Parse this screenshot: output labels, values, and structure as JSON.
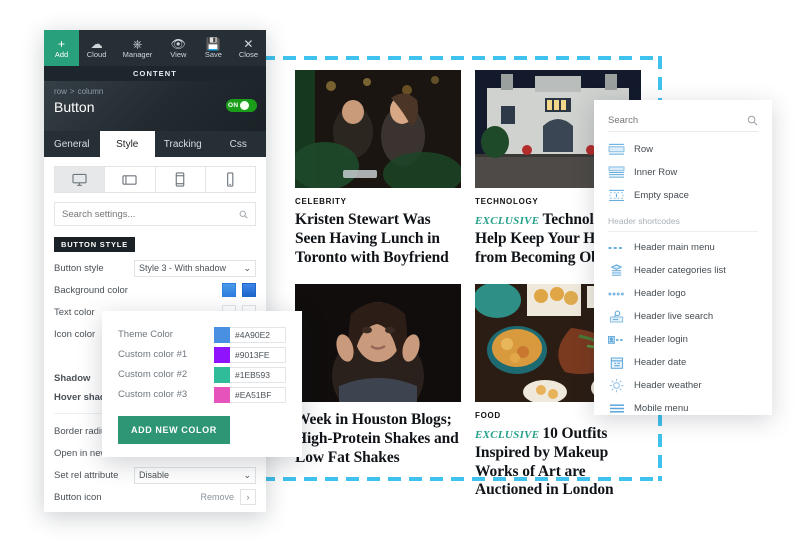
{
  "builder": {
    "toolbar": [
      {
        "label": "Add",
        "icon": "plus-icon"
      },
      {
        "label": "Cloud",
        "icon": "cloud-icon"
      },
      {
        "label": "Manager",
        "icon": "manager-icon"
      },
      {
        "label": "View",
        "icon": "eye-icon"
      },
      {
        "label": "Save",
        "icon": "save-disk-icon"
      },
      {
        "label": "Close",
        "icon": "close-x-icon"
      }
    ],
    "content_bar": "CONTENT",
    "breadcrumb": {
      "parent": "row",
      "separator": ">",
      "child": "column"
    },
    "object_name": "Button",
    "toggle": {
      "label": "ON",
      "state": "on"
    },
    "tabs": [
      {
        "label": "General",
        "active": false
      },
      {
        "label": "Style",
        "active": true
      },
      {
        "label": "Tracking",
        "active": false
      },
      {
        "label": "Css",
        "active": false
      }
    ],
    "devices": [
      {
        "name": "desktop",
        "active": true
      },
      {
        "name": "tablet-landscape",
        "active": false
      },
      {
        "name": "tablet-portrait",
        "active": false
      },
      {
        "name": "mobile",
        "active": false
      }
    ],
    "search": {
      "placeholder": "Search settings...",
      "value": ""
    },
    "section_label": "BUTTON STYLE",
    "fields": {
      "button_style": {
        "label": "Button style",
        "value": "Style 3 - With shadow"
      },
      "background_color": {
        "label": "Background color"
      },
      "text_color": {
        "label": "Text color"
      },
      "icon_color": {
        "label": "Icon color"
      },
      "shadow": {
        "label": "Shadow"
      },
      "hover_shadow": {
        "label": "Hover shadow"
      },
      "border_radius": {
        "label": "Border radius"
      },
      "open_in_new": {
        "label": "Open in new tab"
      },
      "set_rel": {
        "label": "Set rel attribute",
        "value": "Disable"
      },
      "button_icon": {
        "label": "Button icon",
        "action": "Remove"
      }
    }
  },
  "picker": {
    "rows": [
      {
        "name": "Theme Color",
        "hex": "#4A90E2",
        "swatch": "#4a90e2"
      },
      {
        "name": "Custom color #1",
        "hex": "#9013FE",
        "swatch": "#9013fe"
      },
      {
        "name": "Custom color #2",
        "hex": "#1EB593",
        "swatch": "#2ebd98"
      },
      {
        "name": "Custom color #3",
        "hex": "#EA51BF",
        "swatch": "#e653bb"
      }
    ],
    "add_button": "ADD NEW COLOR"
  },
  "shortcodes": {
    "search": {
      "placeholder": "Search",
      "value": ""
    },
    "blocks": [
      {
        "label": "Row",
        "icon": "row-icon"
      },
      {
        "label": "Inner Row",
        "icon": "inner-row-icon"
      },
      {
        "label": "Empty space",
        "icon": "empty-space-icon"
      }
    ],
    "group_label": "Header shortcodes",
    "items": [
      {
        "label": "Header main menu",
        "icon": "dashed-menu-icon"
      },
      {
        "label": "Header categories list",
        "icon": "categories-list-icon"
      },
      {
        "label": "Header logo",
        "icon": "logo-icon"
      },
      {
        "label": "Header live search",
        "icon": "live-search-icon"
      },
      {
        "label": "Header login",
        "icon": "login-icon"
      },
      {
        "label": "Header date",
        "icon": "calendar-icon"
      },
      {
        "label": "Header weather",
        "icon": "sun-icon"
      },
      {
        "label": "Mobile menu",
        "icon": "hamburger-icon"
      }
    ]
  },
  "articles": [
    {
      "category": "CELEBRITY",
      "exclusive": "",
      "title": "Kristen Stewart Was Seen Having Lunch in Toronto with Boyfriend",
      "image": "couple-dining-restaurant"
    },
    {
      "category": "TECHNOLOGY",
      "exclusive": "EXCLUSIVE",
      "title": "Technology to Help Keep Your Home from Becoming Obsolete",
      "image": "luxury-house-night"
    },
    {
      "category": "",
      "exclusive": "",
      "title": "Week in Houston Blogs; High-Protein Shakes and Low Fat Shakes",
      "image": "woman-portrait"
    },
    {
      "category": "FOOD",
      "exclusive": "EXCLUSIVE",
      "title": "10 Outfits Inspired by Makeup Works of Art are Auctioned in London",
      "image": "food-table-spread"
    }
  ],
  "colors": {
    "accent_teal": "#3FC3EE",
    "green": "#28A07B",
    "dark": "#262F36",
    "exclusive_green": "#23a089"
  }
}
